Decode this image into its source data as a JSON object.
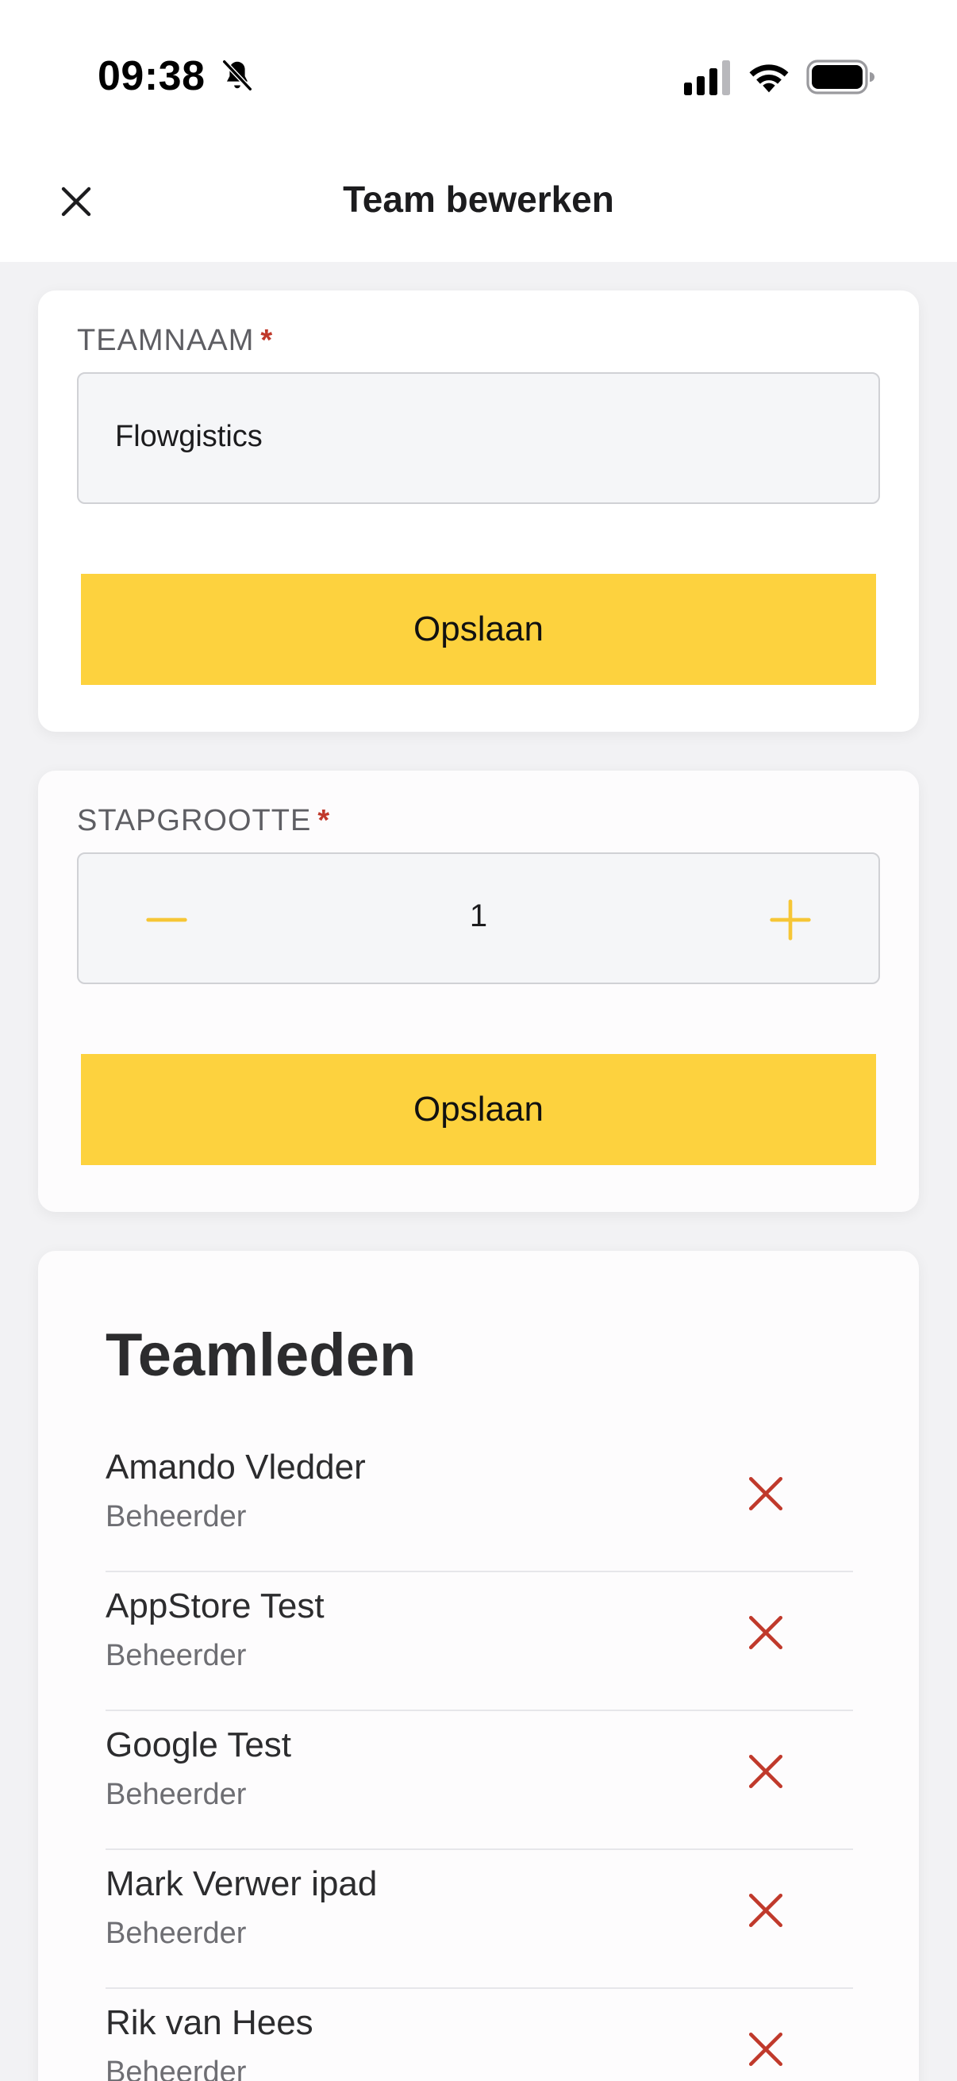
{
  "status_bar": {
    "time": "09:38"
  },
  "header": {
    "title": "Team bewerken"
  },
  "team_name": {
    "label": "TEAMNAAM",
    "required_mark": "*",
    "value": "Flowgistics",
    "save_label": "Opslaan"
  },
  "step_size": {
    "label": "STAPGROOTTE",
    "required_mark": "*",
    "value": "1",
    "save_label": "Opslaan"
  },
  "members": {
    "title": "Teamleden",
    "items": [
      {
        "name": "Amando Vledder",
        "role": "Beheerder"
      },
      {
        "name": "AppStore Test",
        "role": "Beheerder"
      },
      {
        "name": "Google Test",
        "role": "Beheerder"
      },
      {
        "name": "Mark Verwer ipad",
        "role": "Beheerder"
      },
      {
        "name": "Rik van Hees",
        "role": "Beheerder"
      }
    ]
  },
  "colors": {
    "accent": "#fdd23e",
    "stepper_icon": "#f6c636",
    "required": "#c0392b",
    "remove": "#c0392b"
  }
}
